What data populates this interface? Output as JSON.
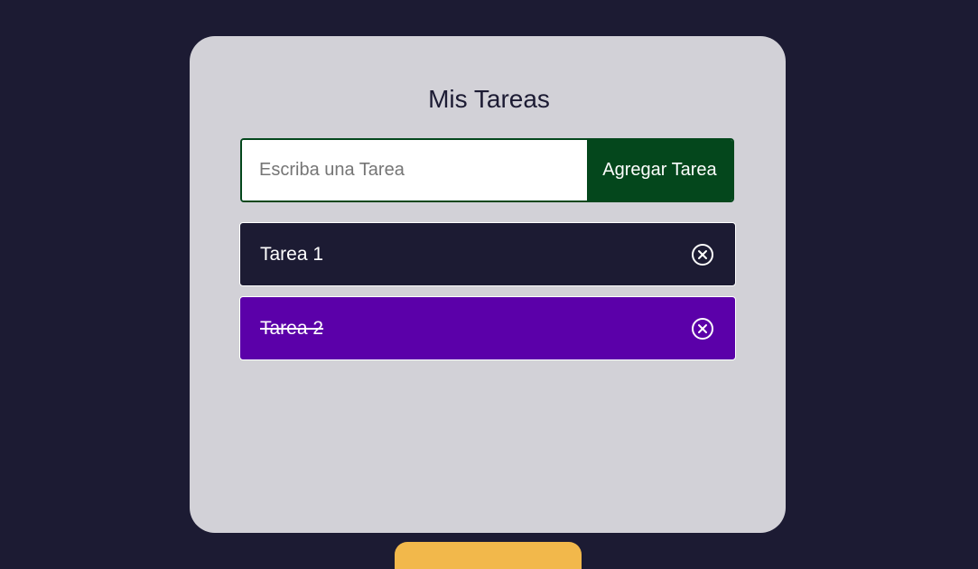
{
  "app": {
    "title": "Mis Tareas"
  },
  "form": {
    "input_value": "",
    "input_placeholder": "Escriba una Tarea",
    "add_label": "Agregar Tarea"
  },
  "tasks": [
    {
      "label": "Tarea 1",
      "completed": false,
      "color": "#1c1b33",
      "icon": "close-circle-icon"
    },
    {
      "label": "Tarea 2",
      "completed": true,
      "color": "#5b00a9",
      "icon": "close-circle-icon"
    }
  ],
  "colors": {
    "background": "#1c1b33",
    "card": "#d2d1d7",
    "accent": "#04471c",
    "completed_task": "#5b00a9",
    "footer_button": "#f2b84b"
  }
}
